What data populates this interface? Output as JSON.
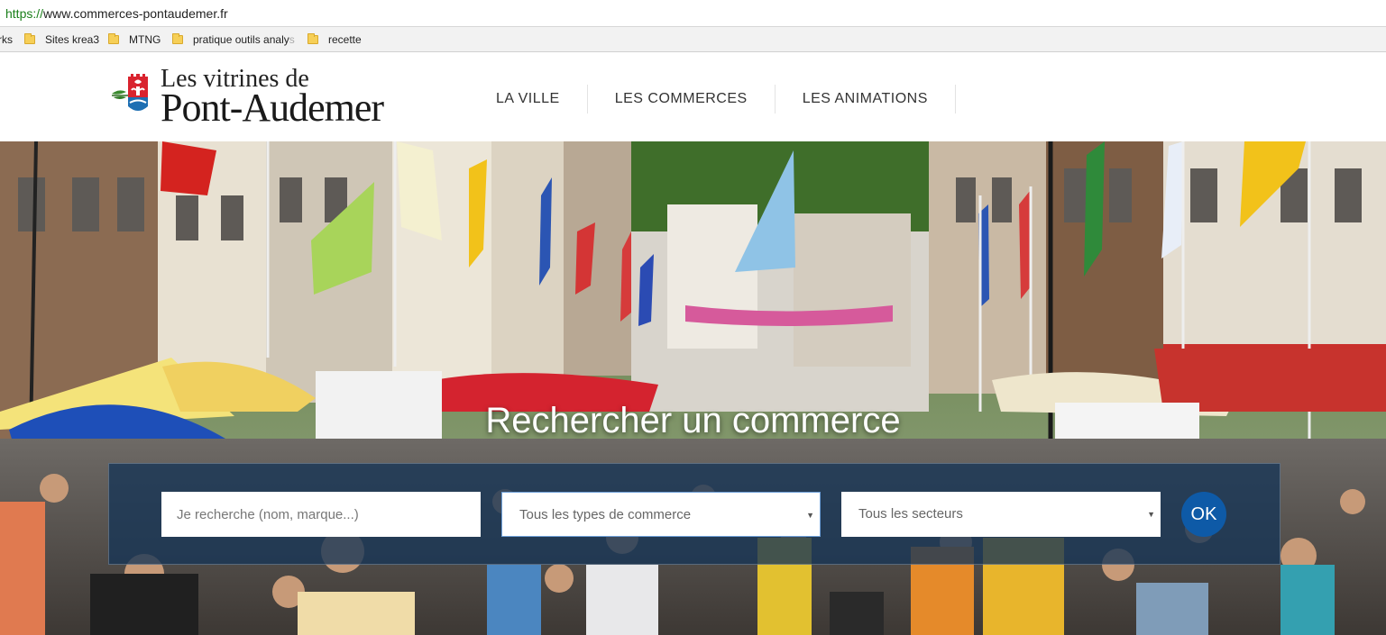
{
  "browser": {
    "url_scheme": "https://",
    "url_host": "www.commerces-pontaudemer.fr",
    "bookmarks": [
      {
        "label": "rks"
      },
      {
        "label": "Sites krea3"
      },
      {
        "label": "MTNG"
      },
      {
        "label": "pratique outils analy",
        "fade": "s"
      },
      {
        "label": "recette"
      }
    ]
  },
  "header": {
    "logo": {
      "line1": "Les vitrines de",
      "line2": "Pont-Audemer"
    },
    "nav": [
      {
        "label": "LA VILLE"
      },
      {
        "label": "LES COMMERCES"
      },
      {
        "label": "LES ANIMATIONS"
      }
    ]
  },
  "hero": {
    "title": "Rechercher un commerce",
    "search": {
      "keyword_placeholder": "Je recherche (nom, marque...)",
      "type_select_value": "Tous les types de commerce",
      "sector_select_value": "Tous les secteurs",
      "submit_label": "OK"
    }
  },
  "colors": {
    "accent": "#0e5aa7",
    "panel": "#163456",
    "url_scheme": "#1a7f1a"
  },
  "icons": {
    "folder": "bookmark-folder-icon",
    "logo": "pont-audemer-crest-icon",
    "dropdown": "dropdown-arrow-icon"
  }
}
